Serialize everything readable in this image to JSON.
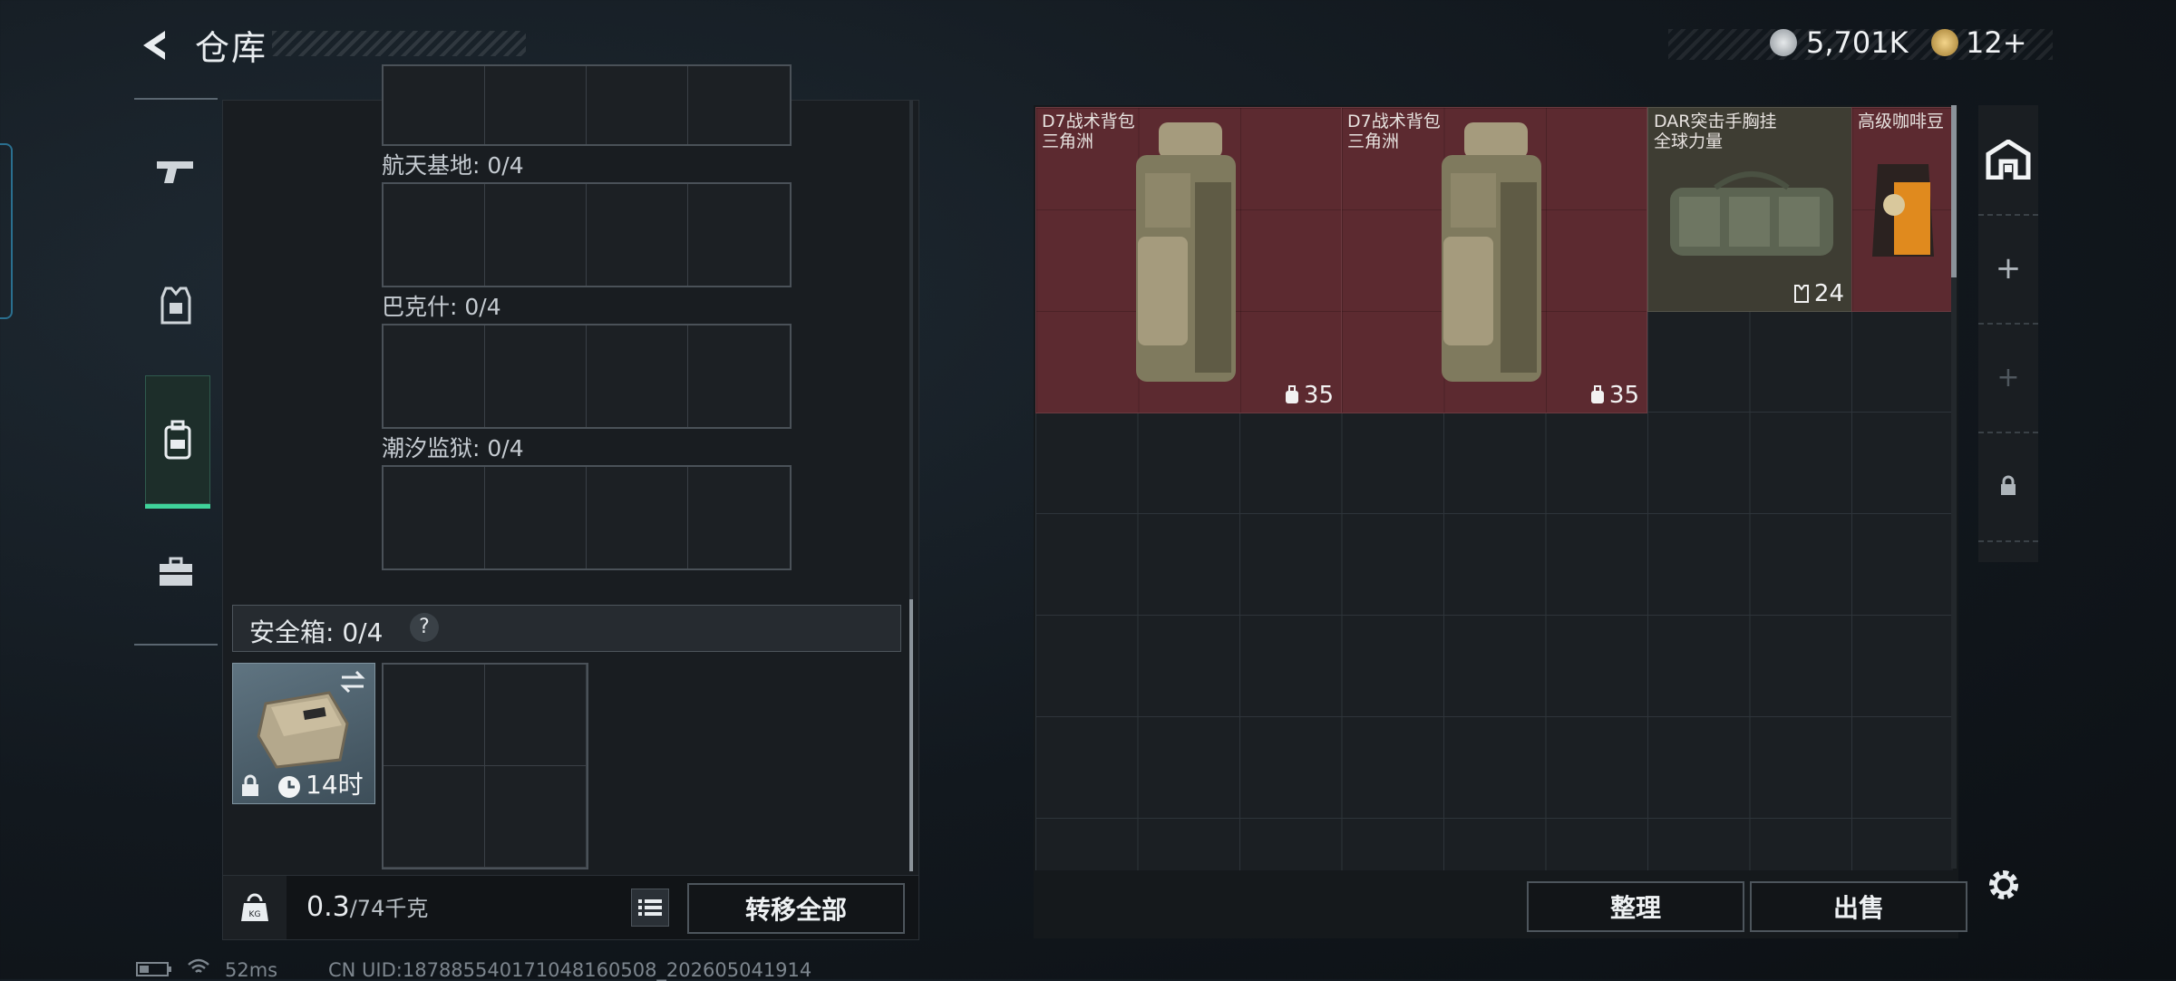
{
  "header": {
    "title": "仓库",
    "currency_primary": "5,701K",
    "currency_secondary": "12+"
  },
  "left_tabs": [
    {
      "name": "weapons"
    },
    {
      "name": "equipment"
    },
    {
      "name": "backpack",
      "active": true
    },
    {
      "name": "toolbox"
    }
  ],
  "left_panel": {
    "groups": [
      {
        "label": ""
      },
      {
        "label": "航天基地: 0/4"
      },
      {
        "label": "巴克什: 0/4"
      },
      {
        "label": "潮汐监狱: 0/4"
      }
    ],
    "safebox": {
      "label": "安全箱:  0/4",
      "help": "?",
      "timer": "14时"
    },
    "footer": {
      "weight_value": "0.3",
      "weight_total": "/74千克",
      "transfer_all": "转移全部"
    }
  },
  "items": [
    {
      "name_line1": "D7战术背包",
      "name_line2": "三角洲",
      "count": "35",
      "rarity": "red"
    },
    {
      "name_line1": "D7战术背包",
      "name_line2": "三角洲",
      "count": "35",
      "rarity": "red"
    },
    {
      "name_line1": "DAR突击手胸挂",
      "name_line2": "全球力量",
      "count": "24",
      "rarity": "olive"
    },
    {
      "name_line1": "高级咖啡豆",
      "name_line2": "",
      "count": "",
      "rarity": "red"
    }
  ],
  "right_footer": {
    "sort": "整理",
    "sell": "出售"
  },
  "status_bar": {
    "ping": "52ms",
    "uid": "CN UID:187885540171048160508_202605041914"
  },
  "colors": {
    "accent_green": "#3fd39a",
    "rarity_red": "#5c2a30",
    "rarity_olive": "#3e3d33"
  }
}
